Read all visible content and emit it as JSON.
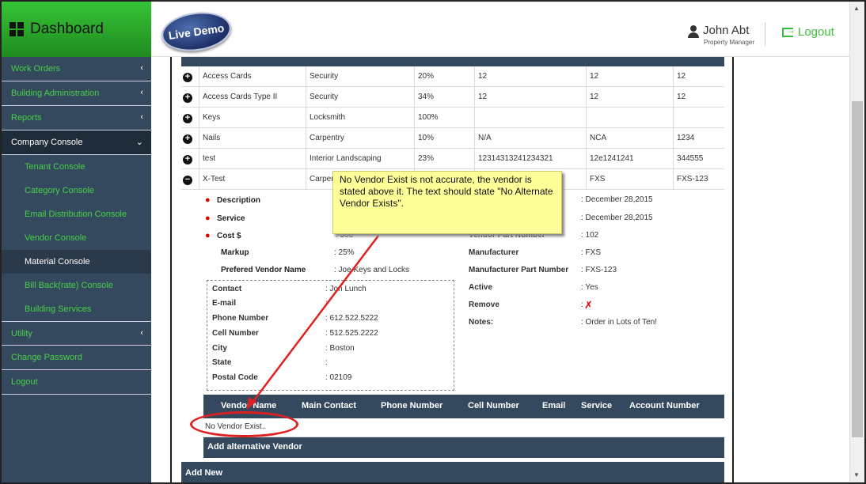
{
  "brand": {
    "title": "Dashboard"
  },
  "sidebar": {
    "items": [
      {
        "label": "Work Orders"
      },
      {
        "label": "Building Administration"
      },
      {
        "label": "Reports"
      },
      {
        "label": "Company Console"
      }
    ],
    "sub_items": [
      {
        "label": "Tenant Console"
      },
      {
        "label": "Category Console"
      },
      {
        "label": "Email Distribution Console"
      },
      {
        "label": "Vendor Console"
      },
      {
        "label": "Material Console"
      },
      {
        "label": "Bill Back(rate) Console"
      },
      {
        "label": "Building Services"
      }
    ],
    "bottom_items": [
      {
        "label": "Utility"
      },
      {
        "label": "Change Password"
      },
      {
        "label": "Logout"
      }
    ]
  },
  "header": {
    "logo_text": "Live Demo",
    "user_name": "John Abt",
    "user_role": "Property Manager",
    "logout_label": "Logout"
  },
  "materials": {
    "rows": [
      [
        "Access Cards",
        "Security",
        "20%",
        "12",
        "12",
        "12"
      ],
      [
        "Access Cards Type II",
        "Security",
        "34%",
        "12",
        "12",
        "12"
      ],
      [
        "Keys",
        "Locksmith",
        "100%",
        "",
        "",
        ""
      ],
      [
        "Nails",
        "Carpentry",
        "10%",
        "N/A",
        "NCA",
        "1234"
      ],
      [
        "test",
        "Interior Landscaping",
        "23%",
        "12314313241234321",
        "12e1241241",
        "344555"
      ],
      [
        "X-Test",
        "Carpentry",
        "",
        "",
        "FXS",
        "FXS-123"
      ]
    ]
  },
  "detail": {
    "left": [
      {
        "label": "Description",
        "value": ""
      },
      {
        "label": "Service",
        "value": ""
      },
      {
        "label": "Cost $",
        "value": ": 300"
      },
      {
        "label": "Markup",
        "value": ": 25%"
      },
      {
        "label": "Prefered Vendor Name",
        "value": ": Joe Keys and Locks"
      }
    ],
    "vendor": [
      {
        "label": "Contact",
        "value": ": Jon Lunch"
      },
      {
        "label": "E-mail",
        "value": ":"
      },
      {
        "label": "Phone Number",
        "value": ": 612.522.5222"
      },
      {
        "label": "Cell Number",
        "value": ": 512.525.2222"
      },
      {
        "label": "City",
        "value": ": Boston"
      },
      {
        "label": "State",
        "value": ":"
      },
      {
        "label": "Postal Code",
        "value": ": 02109"
      }
    ],
    "right": [
      {
        "label": "",
        "value": ": December 28,2015"
      },
      {
        "label": "",
        "value": ": December 28,2015"
      },
      {
        "label": "Vendor Part Number",
        "value": ": 102"
      },
      {
        "label": "Manufacturer",
        "value": ": FXS"
      },
      {
        "label": "Manufacturer Part Number",
        "value": ": FXS-123"
      },
      {
        "label": "Active",
        "value": ": Yes"
      },
      {
        "label": "Remove",
        "value": ":"
      },
      {
        "label": "Notes:",
        "value": ": Order in Lots of Ten!"
      }
    ]
  },
  "alt_vendors": {
    "headers": [
      "Vendor Name",
      "Main Contact",
      "Phone Number",
      "Cell Number",
      "Email",
      "Service",
      "Account Number"
    ],
    "empty_text": "No Vendor Exist..",
    "add_label": "Add alternative Vendor"
  },
  "add_new_label": "Add New",
  "annotation": {
    "text": "No Vendor Exist is not accurate, the vendor is stated above it. The text should state \"No Alternate Vendor Exists\"."
  },
  "colors": {
    "accent_green": "#3bbf3b",
    "nav_bg": "#34495e",
    "callout_red": "#e02020",
    "note_yellow": "#ffff99"
  }
}
